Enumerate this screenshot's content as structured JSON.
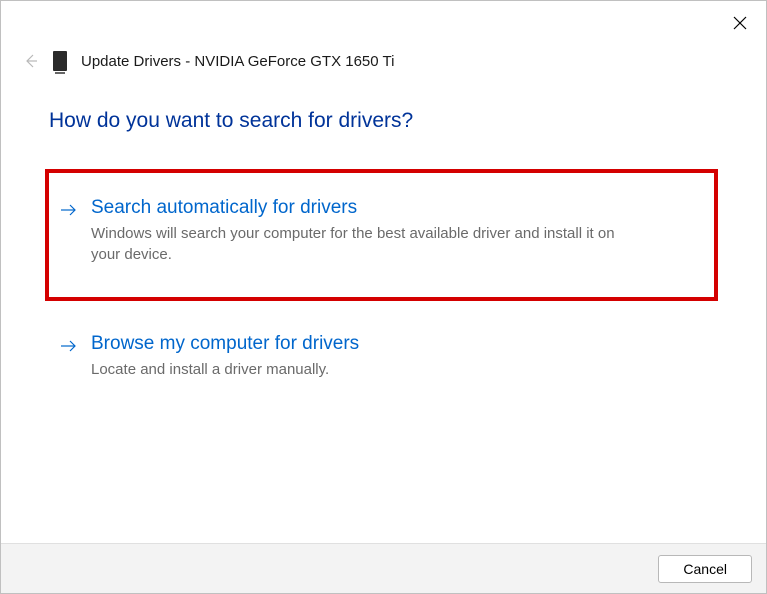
{
  "window": {
    "title": "Update Drivers - NVIDIA GeForce GTX 1650 Ti"
  },
  "question": "How do you want to search for drivers?",
  "options": [
    {
      "title": "Search automatically for drivers",
      "description": "Windows will search your computer for the best available driver and install it on your device."
    },
    {
      "title": "Browse my computer for drivers",
      "description": "Locate and install a driver manually."
    }
  ],
  "footer": {
    "cancel_label": "Cancel"
  }
}
